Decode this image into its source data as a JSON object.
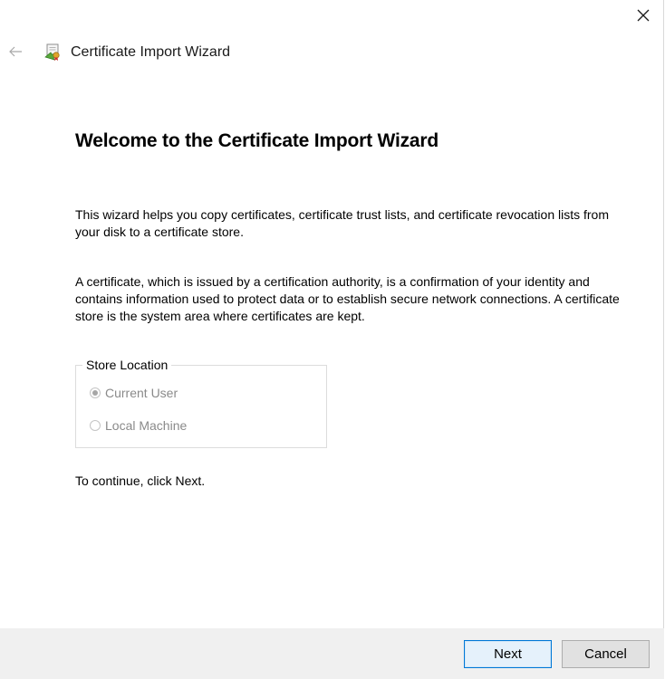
{
  "window": {
    "title": "Certificate Import Wizard"
  },
  "icons": {
    "close": "close-icon",
    "back": "back-arrow-icon",
    "title": "certificate-icon"
  },
  "content": {
    "heading": "Welcome to the Certificate Import Wizard",
    "paragraph1": "This wizard helps you copy certificates, certificate trust lists, and certificate revocation lists from your disk to a certificate store.",
    "paragraph2": "A certificate, which is issued by a certification authority, is a confirmation of your identity and contains information used to protect data or to establish secure network connections. A certificate store is the system area where certificates are kept.",
    "store_location": {
      "legend": "Store Location",
      "options": [
        {
          "label": "Current User",
          "selected": true,
          "enabled": false
        },
        {
          "label": "Local Machine",
          "selected": false,
          "enabled": false
        }
      ]
    },
    "continue_text": "To continue, click Next."
  },
  "footer": {
    "next_label": "Next",
    "cancel_label": "Cancel"
  },
  "colors": {
    "accent_border": "#0078d7",
    "footer_bg": "#f0f0f0",
    "disabled_text": "#8a8a8a"
  }
}
